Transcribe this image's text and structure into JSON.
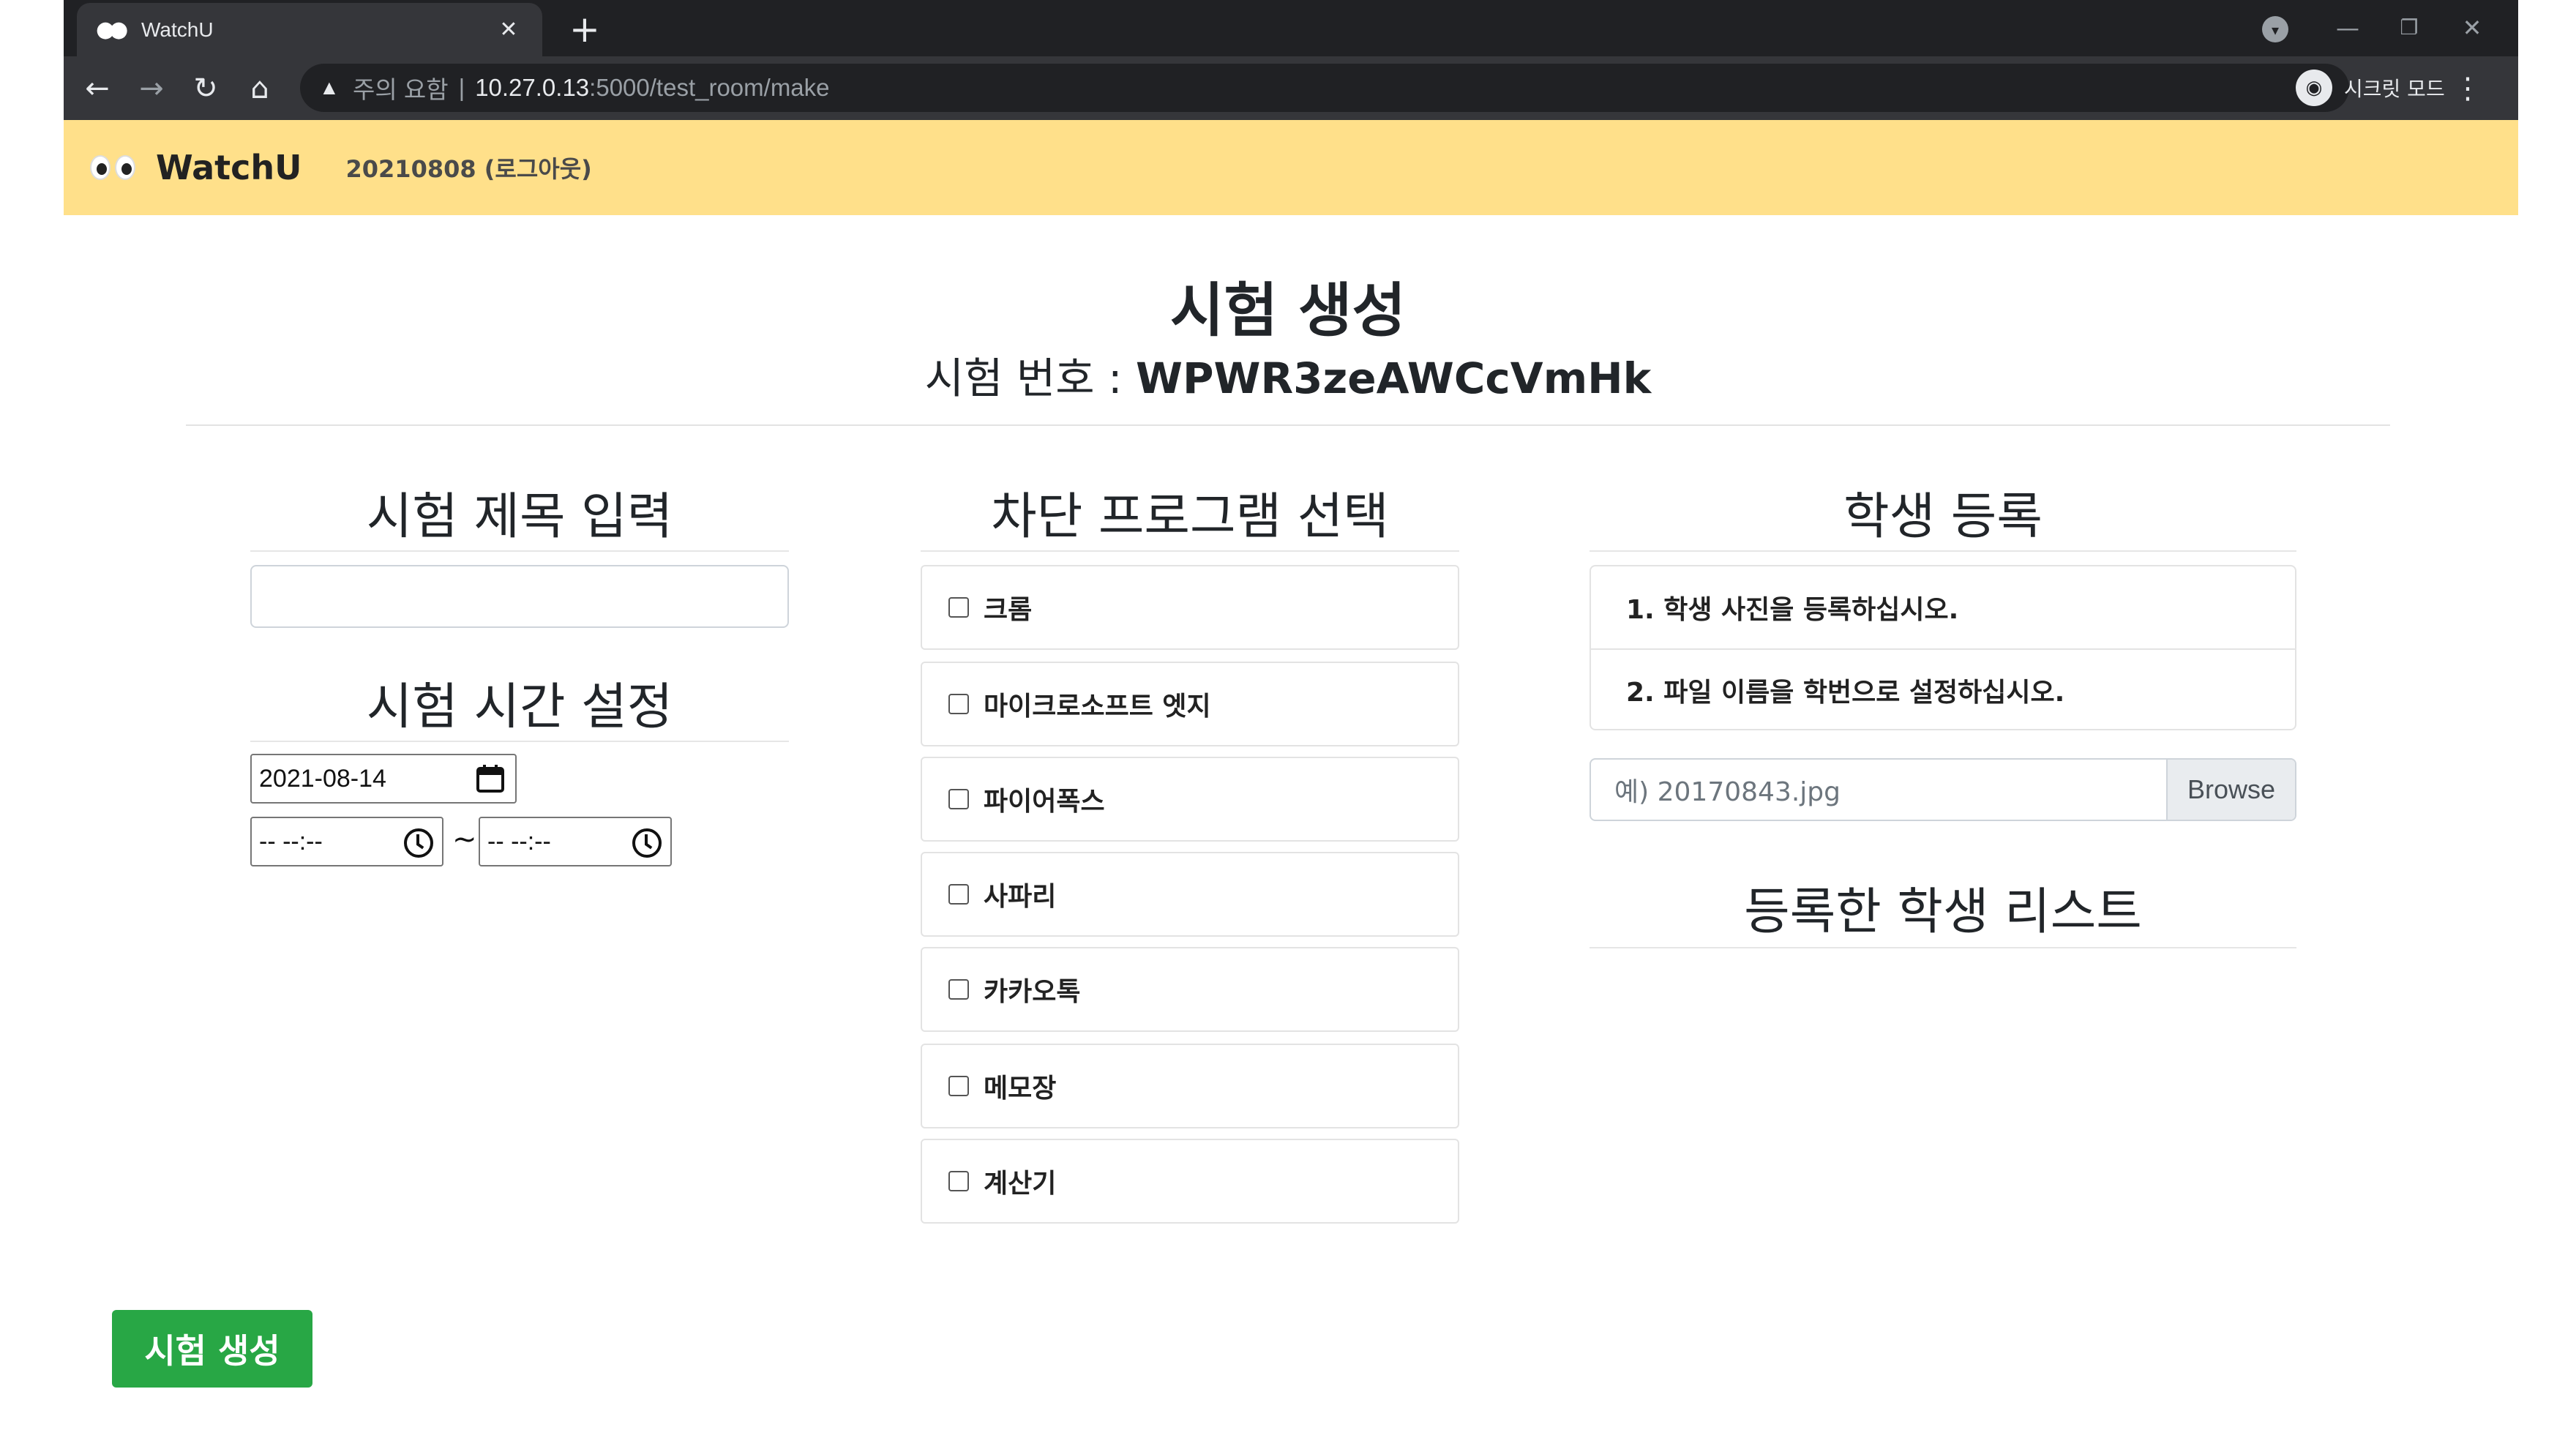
{
  "browser": {
    "tab_title": "WatchU",
    "tab_favicon": "eyes-emoji",
    "new_tab": "+",
    "close_tab": "✕",
    "security_warning": "주의 요함",
    "url_host": "10.27.0.13",
    "url_rest": ":5000/test_room/make",
    "incognito_label": "시크릿 모드"
  },
  "navbar": {
    "brand": "WatchU",
    "user_text": "20210808 (로그아웃)",
    "background": "#ffe08a"
  },
  "header": {
    "title": "시험 생성",
    "code_label": "시험 번호 : ",
    "code_value": "WPWR3zeAWCcVmHk"
  },
  "left": {
    "title_section": "시험 제목 입력",
    "time_section": "시험 시간 설정",
    "date_value": "2021-08-14",
    "start_time": "-- --:--",
    "end_time": "-- --:--",
    "range_sep": "~"
  },
  "middle": {
    "section": "차단 프로그램 선택",
    "programs": [
      "크롬",
      "마이크로소프트 엣지",
      "파이어폭스",
      "사파리",
      "카카오톡",
      "메모장",
      "계산기"
    ]
  },
  "right": {
    "section": "학생 등록",
    "instructions": [
      "1. 학생 사진을 등록하십시오.",
      "2. 파일 이름을 학번으로 설정하십시오."
    ],
    "file_placeholder": "예) 20170843.jpg",
    "browse_label": "Browse",
    "list_section": "등록한 학생 리스트"
  },
  "submit": {
    "label": "시험 생성",
    "color": "#28a745"
  }
}
